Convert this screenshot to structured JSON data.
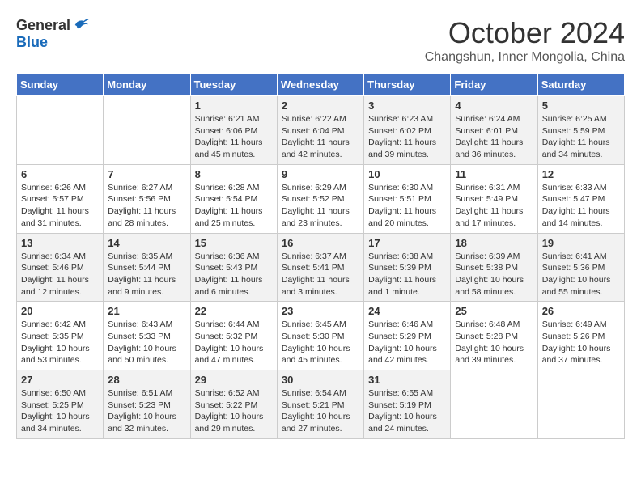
{
  "logo": {
    "general": "General",
    "blue": "Blue"
  },
  "title": "October 2024",
  "location": "Changshun, Inner Mongolia, China",
  "days_of_week": [
    "Sunday",
    "Monday",
    "Tuesday",
    "Wednesday",
    "Thursday",
    "Friday",
    "Saturday"
  ],
  "weeks": [
    [
      {
        "day": "",
        "info": ""
      },
      {
        "day": "",
        "info": ""
      },
      {
        "day": "1",
        "info": "Sunrise: 6:21 AM\nSunset: 6:06 PM\nDaylight: 11 hours and 45 minutes."
      },
      {
        "day": "2",
        "info": "Sunrise: 6:22 AM\nSunset: 6:04 PM\nDaylight: 11 hours and 42 minutes."
      },
      {
        "day": "3",
        "info": "Sunrise: 6:23 AM\nSunset: 6:02 PM\nDaylight: 11 hours and 39 minutes."
      },
      {
        "day": "4",
        "info": "Sunrise: 6:24 AM\nSunset: 6:01 PM\nDaylight: 11 hours and 36 minutes."
      },
      {
        "day": "5",
        "info": "Sunrise: 6:25 AM\nSunset: 5:59 PM\nDaylight: 11 hours and 34 minutes."
      }
    ],
    [
      {
        "day": "6",
        "info": "Sunrise: 6:26 AM\nSunset: 5:57 PM\nDaylight: 11 hours and 31 minutes."
      },
      {
        "day": "7",
        "info": "Sunrise: 6:27 AM\nSunset: 5:56 PM\nDaylight: 11 hours and 28 minutes."
      },
      {
        "day": "8",
        "info": "Sunrise: 6:28 AM\nSunset: 5:54 PM\nDaylight: 11 hours and 25 minutes."
      },
      {
        "day": "9",
        "info": "Sunrise: 6:29 AM\nSunset: 5:52 PM\nDaylight: 11 hours and 23 minutes."
      },
      {
        "day": "10",
        "info": "Sunrise: 6:30 AM\nSunset: 5:51 PM\nDaylight: 11 hours and 20 minutes."
      },
      {
        "day": "11",
        "info": "Sunrise: 6:31 AM\nSunset: 5:49 PM\nDaylight: 11 hours and 17 minutes."
      },
      {
        "day": "12",
        "info": "Sunrise: 6:33 AM\nSunset: 5:47 PM\nDaylight: 11 hours and 14 minutes."
      }
    ],
    [
      {
        "day": "13",
        "info": "Sunrise: 6:34 AM\nSunset: 5:46 PM\nDaylight: 11 hours and 12 minutes."
      },
      {
        "day": "14",
        "info": "Sunrise: 6:35 AM\nSunset: 5:44 PM\nDaylight: 11 hours and 9 minutes."
      },
      {
        "day": "15",
        "info": "Sunrise: 6:36 AM\nSunset: 5:43 PM\nDaylight: 11 hours and 6 minutes."
      },
      {
        "day": "16",
        "info": "Sunrise: 6:37 AM\nSunset: 5:41 PM\nDaylight: 11 hours and 3 minutes."
      },
      {
        "day": "17",
        "info": "Sunrise: 6:38 AM\nSunset: 5:39 PM\nDaylight: 11 hours and 1 minute."
      },
      {
        "day": "18",
        "info": "Sunrise: 6:39 AM\nSunset: 5:38 PM\nDaylight: 10 hours and 58 minutes."
      },
      {
        "day": "19",
        "info": "Sunrise: 6:41 AM\nSunset: 5:36 PM\nDaylight: 10 hours and 55 minutes."
      }
    ],
    [
      {
        "day": "20",
        "info": "Sunrise: 6:42 AM\nSunset: 5:35 PM\nDaylight: 10 hours and 53 minutes."
      },
      {
        "day": "21",
        "info": "Sunrise: 6:43 AM\nSunset: 5:33 PM\nDaylight: 10 hours and 50 minutes."
      },
      {
        "day": "22",
        "info": "Sunrise: 6:44 AM\nSunset: 5:32 PM\nDaylight: 10 hours and 47 minutes."
      },
      {
        "day": "23",
        "info": "Sunrise: 6:45 AM\nSunset: 5:30 PM\nDaylight: 10 hours and 45 minutes."
      },
      {
        "day": "24",
        "info": "Sunrise: 6:46 AM\nSunset: 5:29 PM\nDaylight: 10 hours and 42 minutes."
      },
      {
        "day": "25",
        "info": "Sunrise: 6:48 AM\nSunset: 5:28 PM\nDaylight: 10 hours and 39 minutes."
      },
      {
        "day": "26",
        "info": "Sunrise: 6:49 AM\nSunset: 5:26 PM\nDaylight: 10 hours and 37 minutes."
      }
    ],
    [
      {
        "day": "27",
        "info": "Sunrise: 6:50 AM\nSunset: 5:25 PM\nDaylight: 10 hours and 34 minutes."
      },
      {
        "day": "28",
        "info": "Sunrise: 6:51 AM\nSunset: 5:23 PM\nDaylight: 10 hours and 32 minutes."
      },
      {
        "day": "29",
        "info": "Sunrise: 6:52 AM\nSunset: 5:22 PM\nDaylight: 10 hours and 29 minutes."
      },
      {
        "day": "30",
        "info": "Sunrise: 6:54 AM\nSunset: 5:21 PM\nDaylight: 10 hours and 27 minutes."
      },
      {
        "day": "31",
        "info": "Sunrise: 6:55 AM\nSunset: 5:19 PM\nDaylight: 10 hours and 24 minutes."
      },
      {
        "day": "",
        "info": ""
      },
      {
        "day": "",
        "info": ""
      }
    ]
  ]
}
